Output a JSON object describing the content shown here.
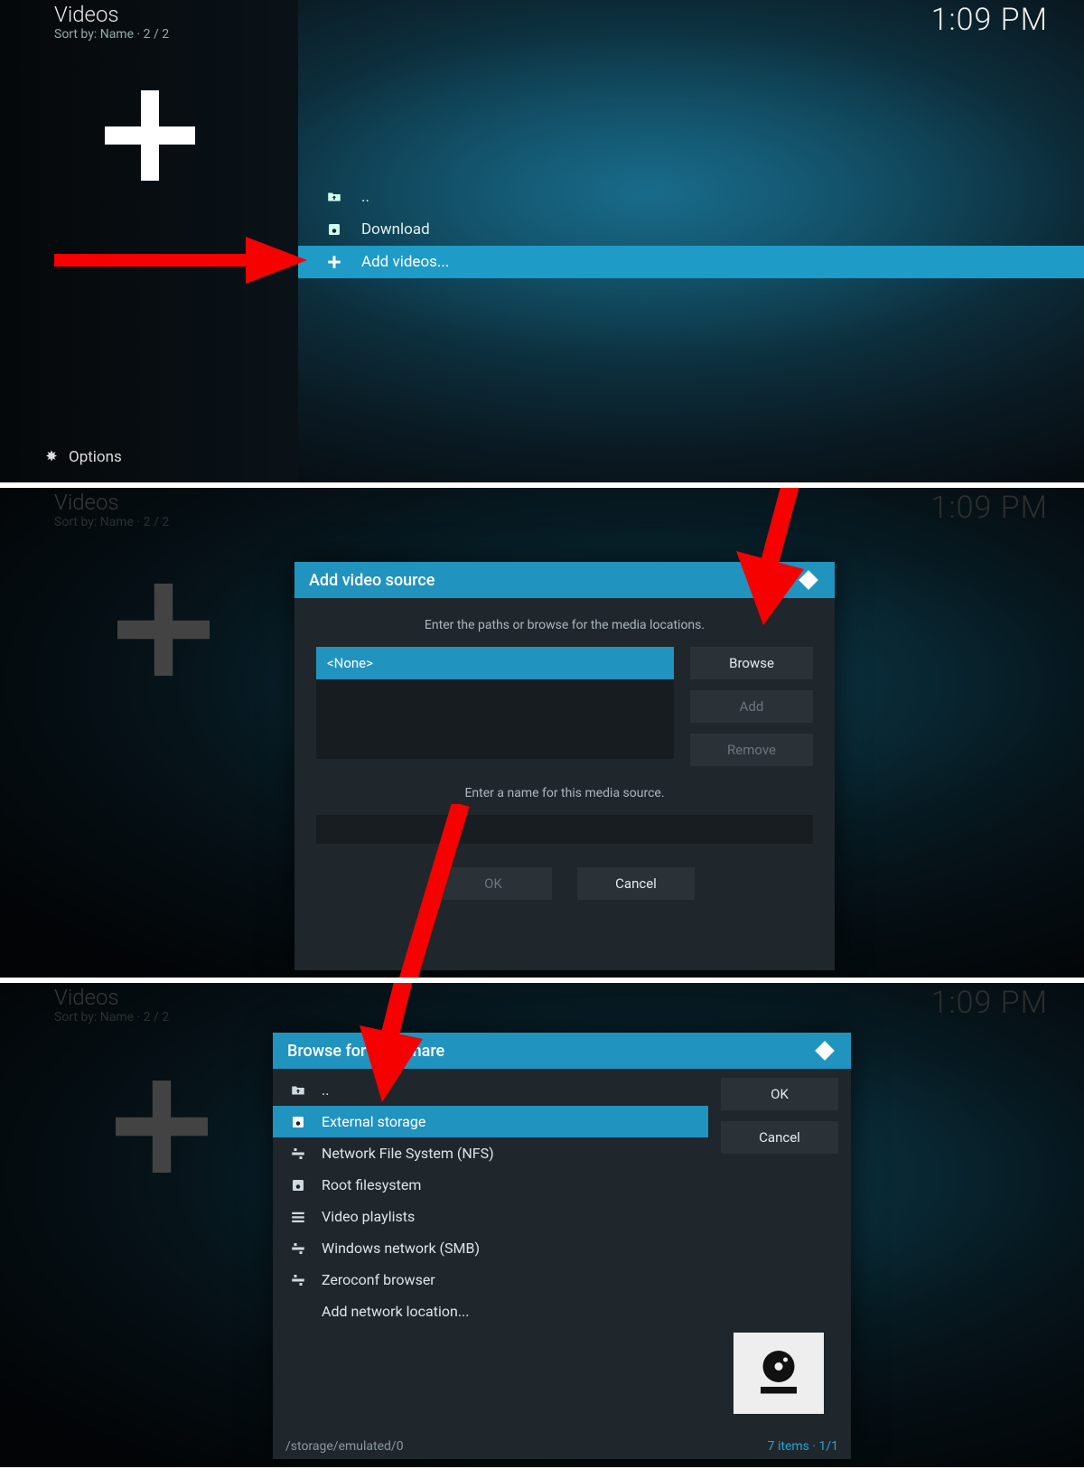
{
  "clock": "1:09 PM",
  "header": {
    "title": "Videos",
    "sort": "Sort by: Name  ·  2 / 2",
    "options": "Options"
  },
  "panel1_items": [
    {
      "icon": "folder-up",
      "label": ".."
    },
    {
      "icon": "disk",
      "label": "Download"
    },
    {
      "icon": "plus",
      "label": "Add videos...",
      "selected": true
    }
  ],
  "add_source": {
    "title": "Add video source",
    "prompt": "Enter the paths or browse for the media locations.",
    "none": "<None>",
    "browse": "Browse",
    "add": "Add",
    "remove": "Remove",
    "name_prompt": "Enter a name for this media source.",
    "ok": "OK",
    "cancel": "Cancel"
  },
  "browse": {
    "title": "Browse for new share",
    "ok": "OK",
    "cancel": "Cancel",
    "items": [
      {
        "icon": "folder-up",
        "label": ".."
      },
      {
        "icon": "disk",
        "label": "External storage",
        "selected": true
      },
      {
        "icon": "net",
        "label": "Network File System (NFS)"
      },
      {
        "icon": "disk",
        "label": "Root filesystem"
      },
      {
        "icon": "list",
        "label": "Video playlists"
      },
      {
        "icon": "net",
        "label": "Windows network (SMB)"
      },
      {
        "icon": "net",
        "label": "Zeroconf browser"
      },
      {
        "icon": "none",
        "label": "Add network location..."
      }
    ],
    "path": "/storage/emulated/0",
    "count": "7 items · 1/1"
  }
}
